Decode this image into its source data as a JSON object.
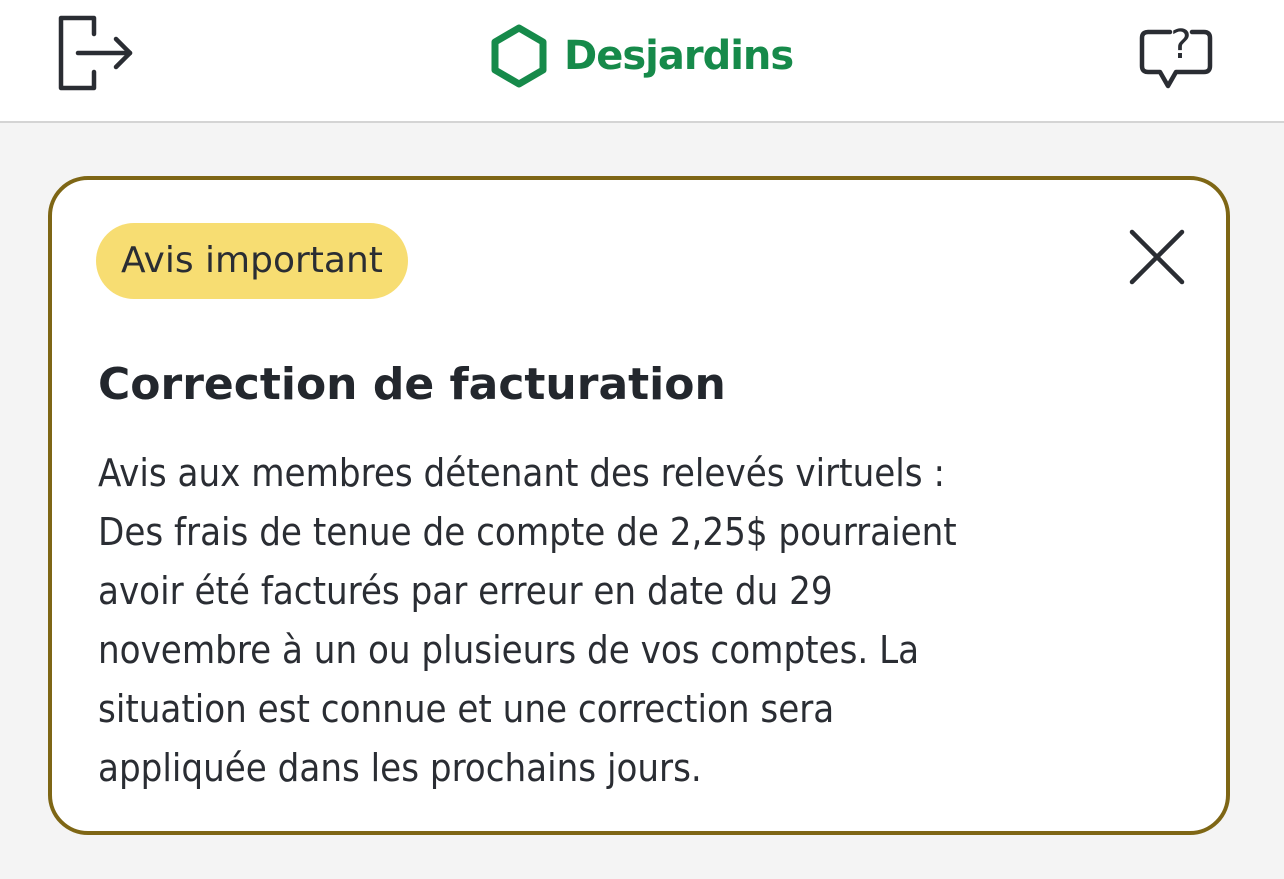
{
  "header": {
    "brand_name": "Desjardins",
    "brand_color": "#168a4a",
    "left_icon": "logout-icon",
    "right_icon": "help-chat-icon"
  },
  "notice": {
    "badge": "Avis important",
    "badge_color": "#f7dd72",
    "border_color": "#7e6615",
    "close_icon": "close-icon",
    "title": "Correction de facturation",
    "body_lines": [
      "Avis aux membres détenant des relevés virtuels :",
      "Des frais de tenue de compte de 2,25$ pourraient",
      "avoir été facturés par erreur en date du 29",
      "novembre à un ou plusieurs de vos comptes. La",
      "situation est connue et une correction sera",
      "appliquée dans les prochains jours."
    ]
  }
}
